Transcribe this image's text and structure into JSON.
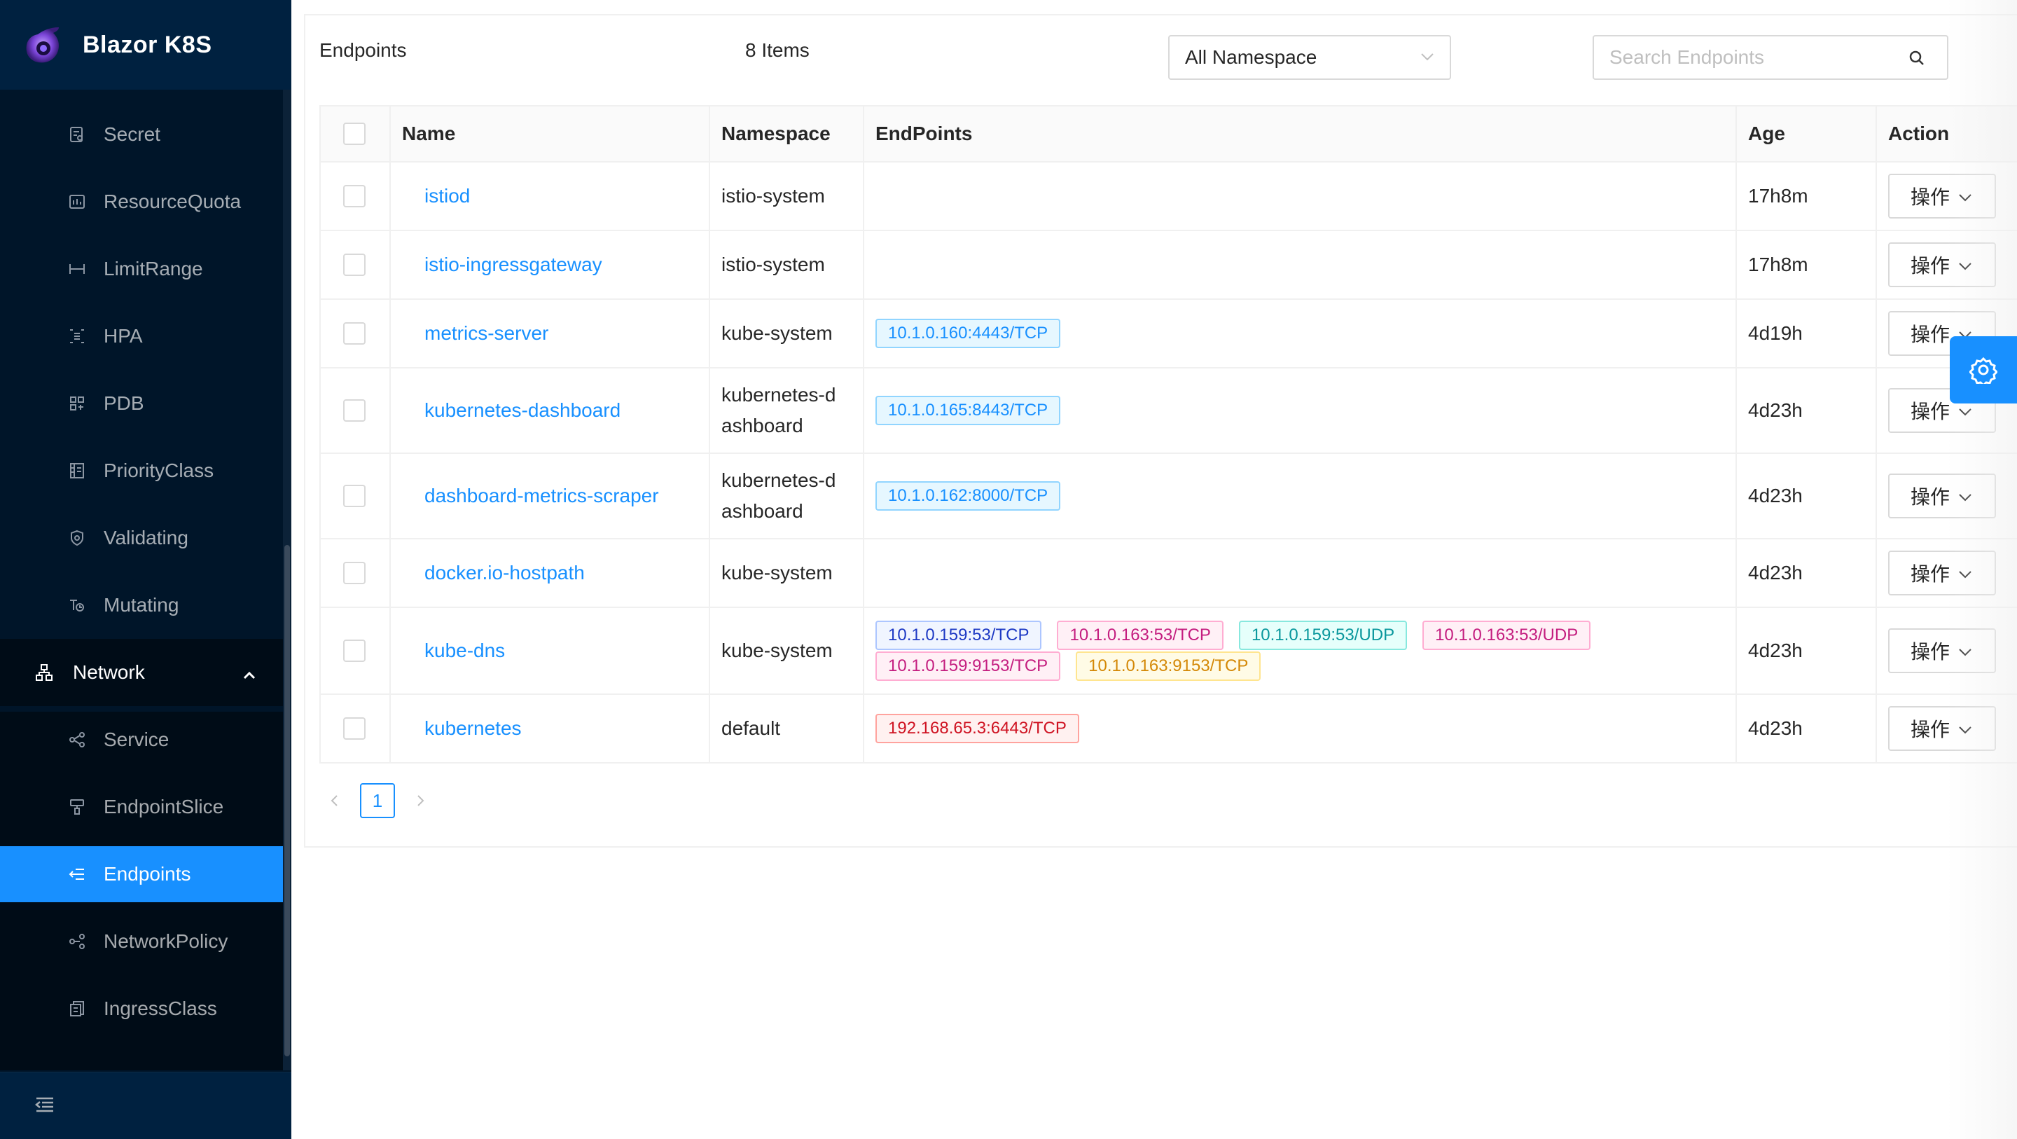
{
  "brand": {
    "title": "Blazor K8S"
  },
  "sidebar": {
    "items": [
      {
        "label": "Secret",
        "icon": "secret-icon"
      },
      {
        "label": "ResourceQuota",
        "icon": "resourcequota-icon"
      },
      {
        "label": "LimitRange",
        "icon": "limitrange-icon"
      },
      {
        "label": "HPA",
        "icon": "hpa-icon"
      },
      {
        "label": "PDB",
        "icon": "pdb-icon"
      },
      {
        "label": "PriorityClass",
        "icon": "priorityclass-icon"
      },
      {
        "label": "Validating",
        "icon": "validating-icon"
      },
      {
        "label": "Mutating",
        "icon": "mutating-icon"
      }
    ],
    "group": {
      "label": "Network",
      "icon": "network-icon",
      "expanded": true
    },
    "sub_items": [
      {
        "label": "Service",
        "icon": "service-icon"
      },
      {
        "label": "EndpointSlice",
        "icon": "endpointslice-icon"
      },
      {
        "label": "Endpoints",
        "icon": "endpoints-icon",
        "active": true
      },
      {
        "label": "NetworkPolicy",
        "icon": "networkpolicy-icon"
      },
      {
        "label": "IngressClass",
        "icon": "ingressclass-icon"
      }
    ]
  },
  "header": {
    "title": "Endpoints",
    "count": "8 Items",
    "namespace_select": "All Namespace",
    "search_placeholder": "Search Endpoints"
  },
  "table": {
    "columns": [
      "Name",
      "Namespace",
      "EndPoints",
      "Age",
      "Action"
    ],
    "action_label": "操作",
    "rows": [
      {
        "name": "istiod",
        "namespace": "istio-system",
        "endpoints": [],
        "age": "17h8m"
      },
      {
        "name": "istio-ingressgateway",
        "namespace": "istio-system",
        "endpoints": [],
        "age": "17h8m"
      },
      {
        "name": "metrics-server",
        "namespace": "kube-system",
        "endpoints": [
          {
            "text": "10.1.0.160:4443/TCP",
            "color": "blue"
          }
        ],
        "age": "4d19h"
      },
      {
        "name": "kubernetes-dashboard",
        "namespace_lines": [
          "kubernetes-d",
          "ashboard"
        ],
        "endpoints": [
          {
            "text": "10.1.0.165:8443/TCP",
            "color": "blue"
          }
        ],
        "age": "4d23h"
      },
      {
        "name": "dashboard-metrics-scraper",
        "namespace_lines": [
          "kubernetes-d",
          "ashboard"
        ],
        "endpoints": [
          {
            "text": "10.1.0.162:8000/TCP",
            "color": "blue"
          }
        ],
        "age": "4d23h"
      },
      {
        "name": "docker.io-hostpath",
        "namespace": "kube-system",
        "endpoints": [],
        "age": "4d23h"
      },
      {
        "name": "kube-dns",
        "namespace": "kube-system",
        "endpoints": [
          {
            "text": "10.1.0.159:53/TCP",
            "color": "geekblue"
          },
          {
            "text": "10.1.0.163:53/TCP",
            "color": "magenta"
          },
          {
            "text": "10.1.0.159:53/UDP",
            "color": "cyan"
          },
          {
            "text": "10.1.0.163:53/UDP",
            "color": "magenta"
          },
          {
            "text": "10.1.0.159:9153/TCP",
            "color": "magenta"
          },
          {
            "text": "10.1.0.163:9153/TCP",
            "color": "gold"
          }
        ],
        "age": "4d23h"
      },
      {
        "name": "kubernetes",
        "namespace": "default",
        "endpoints": [
          {
            "text": "192.168.65.3:6443/TCP",
            "color": "red"
          }
        ],
        "age": "4d23h"
      }
    ]
  },
  "pagination": {
    "current": "1"
  },
  "colors": {
    "primary": "#1890ff",
    "sidebar_bg": "#001529",
    "submenu_bg": "#000c17"
  }
}
